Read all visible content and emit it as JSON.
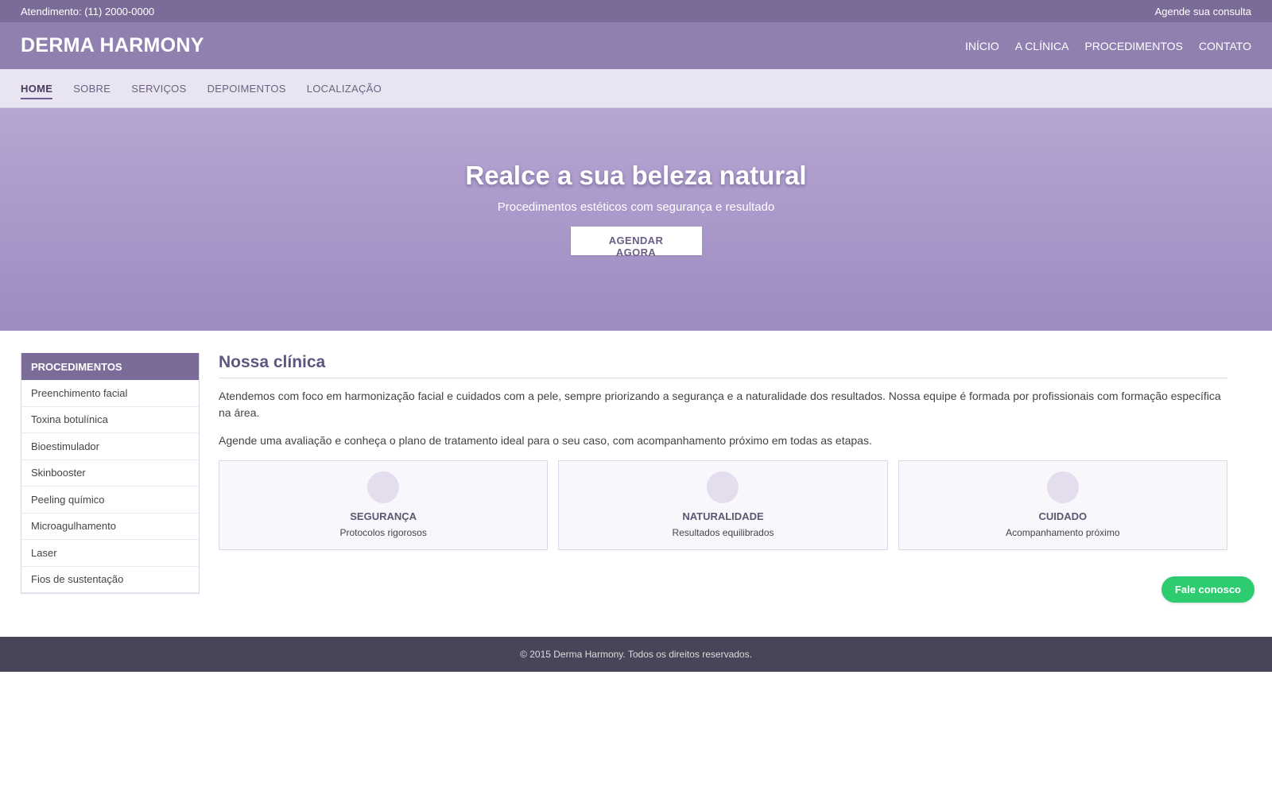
{
  "topbar": {
    "phone": "Atendimento: (11) 2000-0000",
    "schedule_link": "Agende sua consulta"
  },
  "header": {
    "brand": "DERMA HARMONY",
    "nav": [
      "INÍCIO",
      "A CLÍNICA",
      "PROCEDIMENTOS",
      "CONTATO"
    ]
  },
  "subnav": {
    "items": [
      "HOME",
      "SOBRE",
      "SERVIÇOS",
      "DEPOIMENTOS",
      "LOCALIZAÇÃO"
    ],
    "active": "HOME"
  },
  "hero": {
    "title": "Realce a sua beleza natural",
    "subtitle": "Procedimentos estéticos com segurança e resultado",
    "cta": "AGENDAR AGORA"
  },
  "sidebar": {
    "title": "PROCEDIMENTOS",
    "items": [
      "Preenchimento facial",
      "Toxina botulínica",
      "Bioestimulador",
      "Skinbooster",
      "Peeling químico",
      "Microagulhamento",
      "Laser",
      "Fios de sustentação"
    ]
  },
  "main": {
    "title": "Nossa clínica",
    "paragraphs": [
      "Atendemos com foco em harmonização facial e cuidados com a pele, sempre priorizando a segurança e a naturalidade dos resultados. Nossa equipe é formada por profissionais com formação específica na área.",
      "Agende uma avaliação e conheça o plano de tratamento ideal para o seu caso, com acompanhamento próximo em todas as etapas."
    ],
    "features": [
      {
        "title": "SEGURANÇA",
        "desc": "Protocolos rigorosos"
      },
      {
        "title": "NATURALIDADE",
        "desc": "Resultados equilibrados"
      },
      {
        "title": "CUIDADO",
        "desc": "Acompanhamento próximo"
      }
    ]
  },
  "chat": {
    "label": "Fale conosco"
  },
  "footer": {
    "text": "© 2015 Derma Harmony. Todos os direitos reservados."
  },
  "colors": {
    "topbar": "#7b6b98",
    "header": "#8f80b0",
    "accent": "#5e5580",
    "chat": "#2ecc71",
    "footer": "#4a4458"
  }
}
